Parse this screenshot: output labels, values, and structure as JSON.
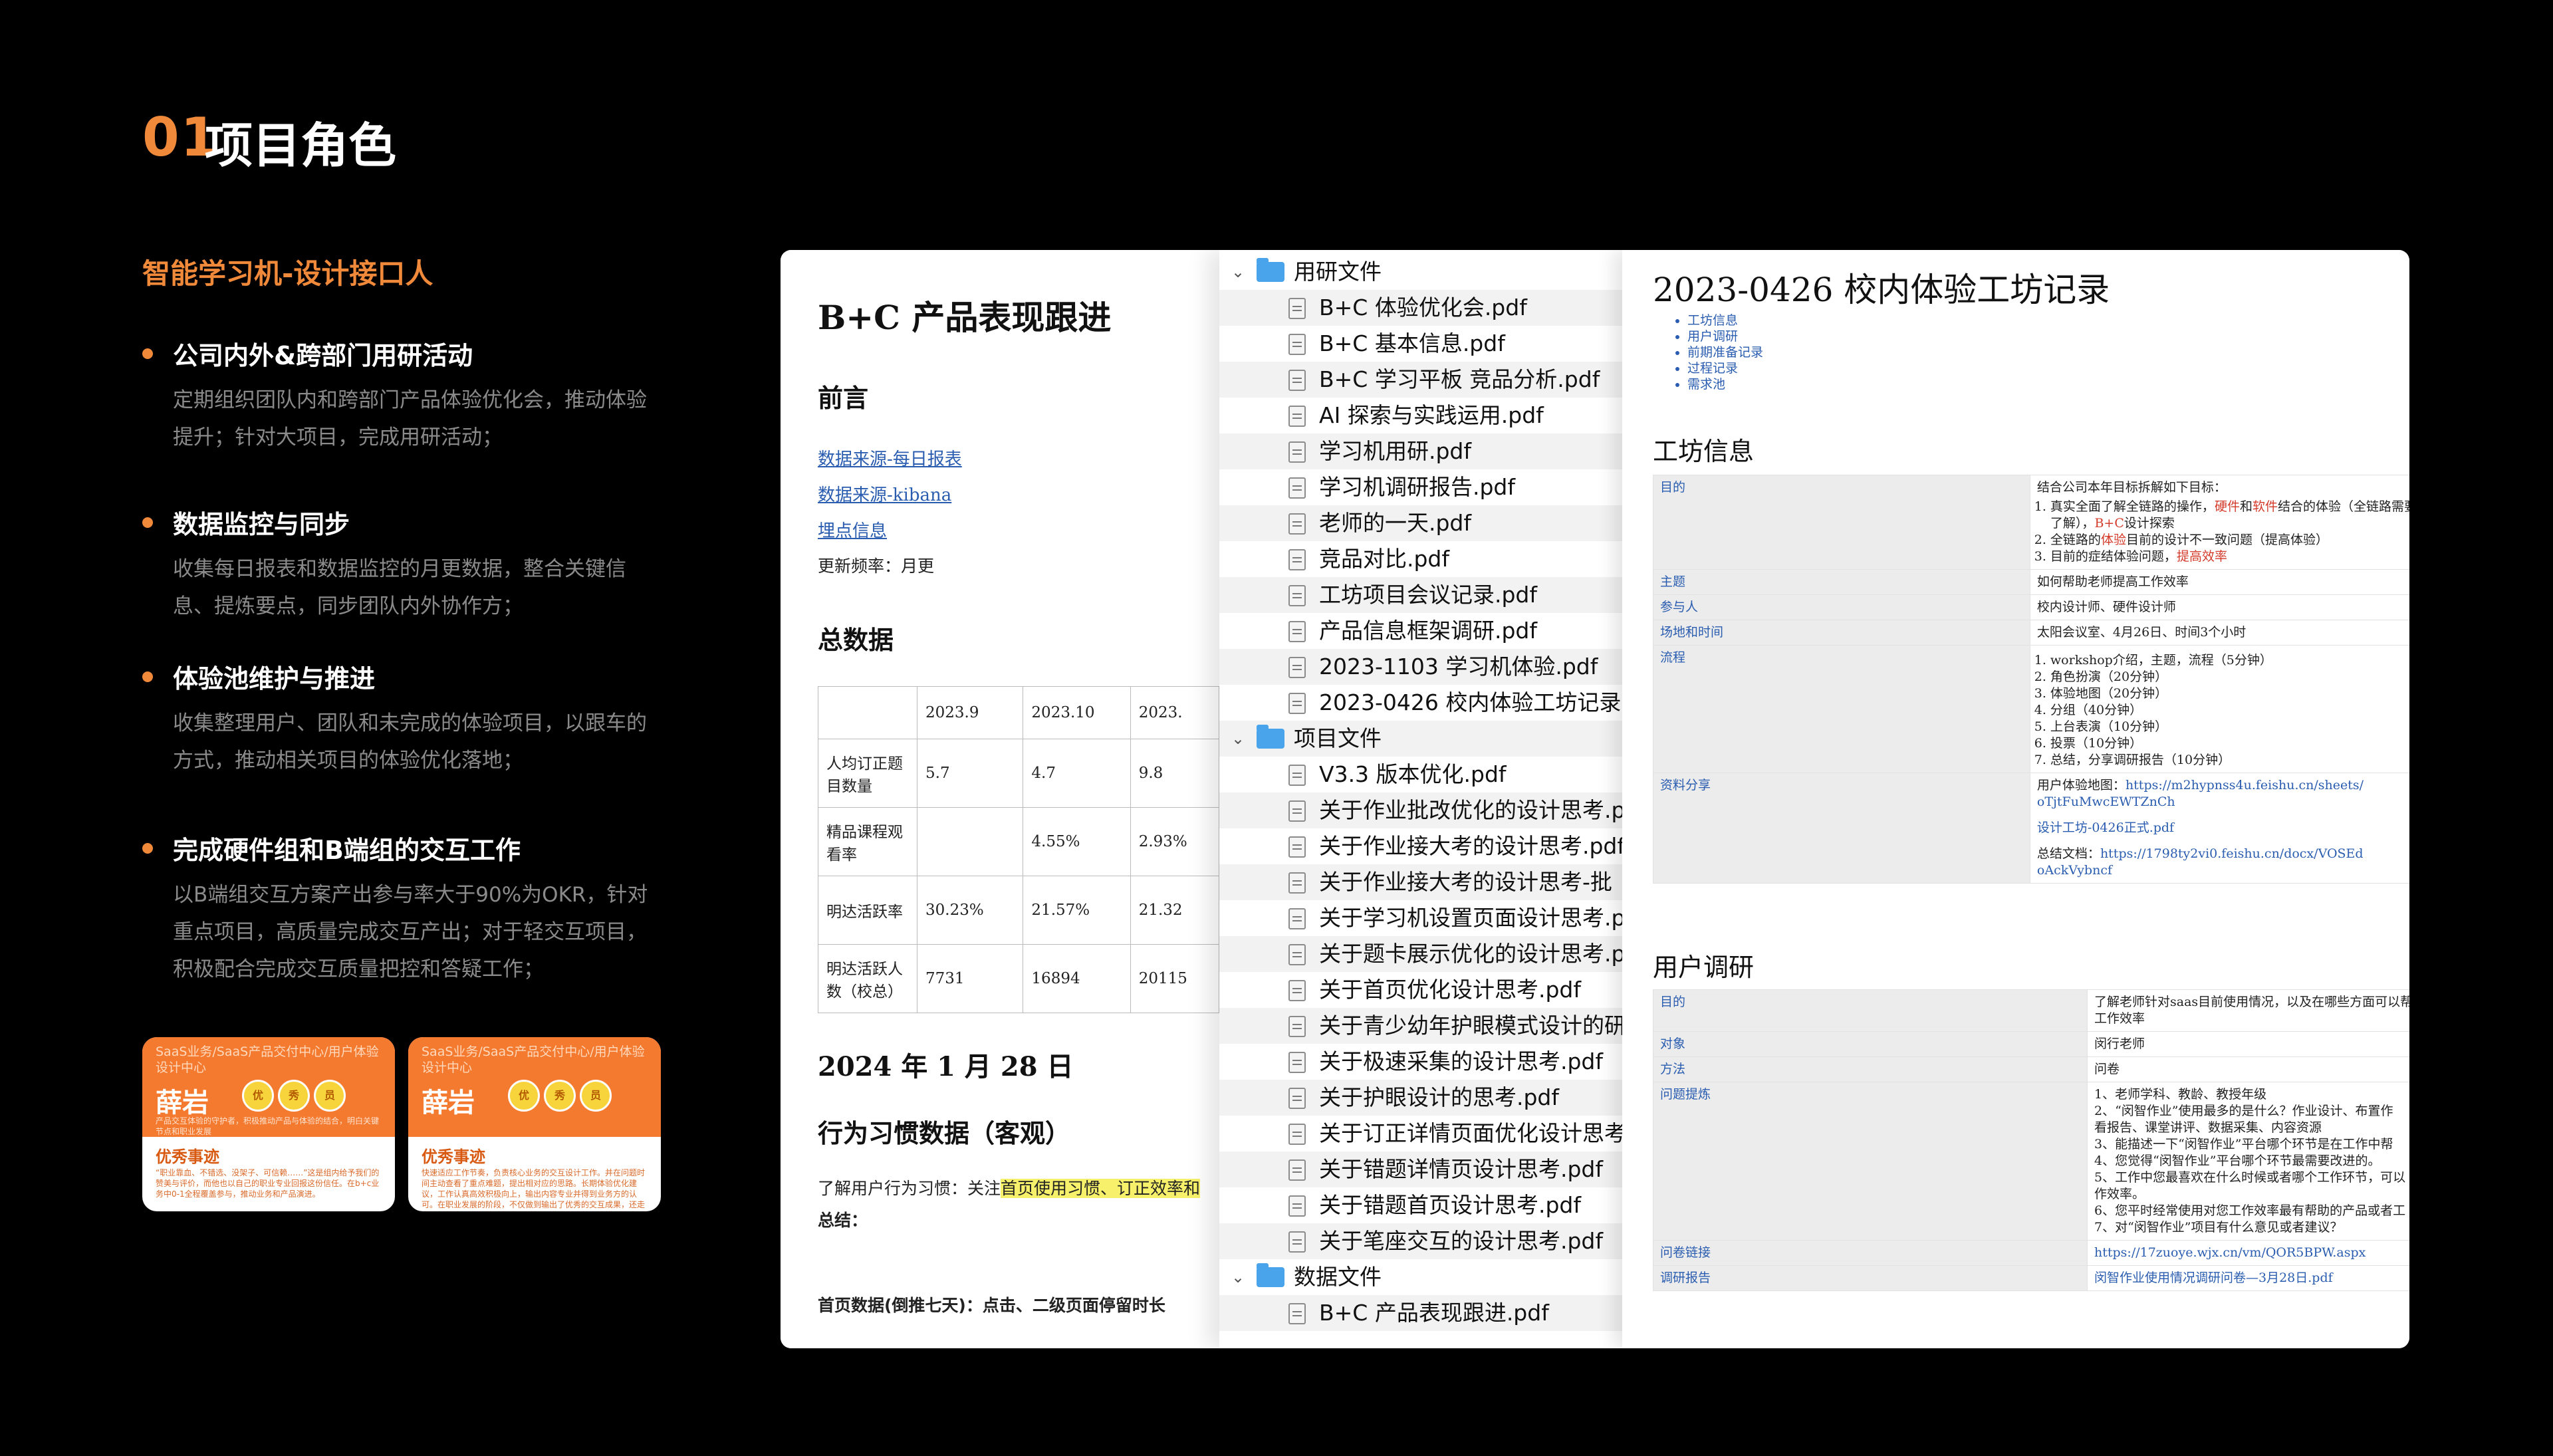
{
  "header": {
    "num": "01",
    "title": "项目角色"
  },
  "subtitle": "智能学习机-设计接口人",
  "points": [
    {
      "title": "公司内外&跨部门用研活动",
      "desc": "定期组织团队内和跨部门产品体验优化会，推动体验提升；针对大项目，完成用研活动；"
    },
    {
      "title": "数据监控与同步",
      "desc": "收集每日报表和数据监控的月更数据，整合关键信息、提炼要点，同步团队内外协作方；"
    },
    {
      "title": "体验池维护与推进",
      "desc": "收集整理用户、团队和未完成的体验项目，以跟车的方式，推动相关项目的体验优化落地；"
    },
    {
      "title": "完成硬件组和B端组的交互工作",
      "desc": "以B端组交互方案产出参与率大于90%为OKR，针对重点项目，高质量完成交互产出；对于轻交互项目，积极配合完成交互质量把控和答疑工作；"
    }
  ],
  "cards": [
    {
      "org": "SaaS业务/SaaS产品交付中心/用户体验设计中心",
      "name": "薛岩",
      "tags": [
        "优",
        "秀",
        "员"
      ],
      "desc": "产品交互体验的守护者，积极推动产品与体验的结合，明白关键节点和职业发展",
      "award": "优秀事迹",
      "award_desc": "“职业靠血、不错选、没架子、可信赖……”这是组内给予我们的赞美与评价，而他也以自己的职业专业回报这份信任。在b+c业务中0-1全程覆盖参与，推动业务和产品演进。"
    },
    {
      "org": "SaaS业务/SaaS产品交付中心/用户体验设计中心",
      "name": "薛岩",
      "tags": [
        "优",
        "秀",
        "员"
      ],
      "desc": "",
      "award": "优秀事迹",
      "award_desc": "快速适应工作节奏，负责核心业务的交互设计工作。并在问题时间主动查看了重点难题，提出相对应的思路。长期体验优化建议，工作认真高效积极向上，输出内容专业并得到业务方的认可。在职业发展的阶段，不仅做到输出了优秀的交互成果，还走查分析输出了多份体验报告，对框架搭建和我的产品模型提高了充分的扫描工作，超预期完成结果。"
    }
  ],
  "doc_a": {
    "title": "B+C 产品表现跟进",
    "preface": "前言",
    "links": [
      "数据来源-每日报表",
      "数据来源-kibana",
      "埋点信息"
    ],
    "freq": "更新频率：月更",
    "total": "总数据",
    "table": {
      "headers": [
        "",
        "2023.9",
        "2023.10",
        "2023."
      ],
      "rows": [
        [
          "人均订正题目数量",
          "5.7",
          "4.7",
          "9.8"
        ],
        [
          "精品课程观看率",
          "",
          "4.55%",
          "2.93%"
        ],
        [
          "明达活跃率",
          "30.23%",
          "21.57%",
          "21.32"
        ],
        [
          "明达活跃人数（校总）",
          "7731",
          "16894",
          "20115"
        ]
      ]
    },
    "date": "2024 年 1 月 28 日",
    "behavior": "行为习惯数据（客观）",
    "understand_prefix": "了解用户行为习惯：关注",
    "understand_hl": "首页使用习惯、订正效率和",
    "summary": "总结：",
    "homepage": "首页数据(倒推七天)：点击、二级页面停留时长"
  },
  "tree": {
    "folders": [
      {
        "name": "用研文件",
        "files": [
          "B+C 体验优化会.pdf",
          "B+C 基本信息.pdf",
          "B+C 学习平板 竞品分析.pdf",
          "AI 探索与实践运用.pdf",
          "学习机用研.pdf",
          "学习机调研报告.pdf",
          "老师的一天.pdf",
          "竞品对比.pdf",
          "工坊项目会议记录.pdf",
          "产品信息框架调研.pdf",
          "2023-1103 学习机体验.pdf",
          "2023-0426 校内体验工坊记录"
        ]
      },
      {
        "name": "项目文件",
        "files": [
          "V3.3 版本优化.pdf",
          "关于作业批改优化的设计思考.p",
          "关于作业接大考的设计思考.pdf",
          "关于作业接大考的设计思考-批",
          "关于学习机设置页面设计思考.p",
          "关于题卡展示优化的设计思考.p",
          "关于首页优化设计思考.pdf",
          "关于青少幼年护眼模式设计的研",
          "关于极速采集的设计思考.pdf",
          "关于护眼设计的思考.pdf",
          "关于订正详情页面优化设计思考",
          "关于错题详情页设计思考.pdf",
          "关于错题首页设计思考.pdf",
          "关于笔座交互的设计思考.pdf"
        ]
      },
      {
        "name": "数据文件",
        "files": [
          "B+C 产品表现跟进.pdf"
        ]
      }
    ]
  },
  "doc_b": {
    "title": "2023-0426 校内体验工坊记录",
    "toc": [
      "工坊信息",
      "用户调研",
      "前期准备记录",
      "过程记录",
      "需求池"
    ],
    "sec1": "工坊信息",
    "goal_key": "目的",
    "goal_intro": "结合公司本年目标拆解如下目标：",
    "goal_items": [
      {
        "pre": "真实全面了解全链路的操作，",
        "r1": "硬件",
        "mid": "和",
        "r2": "软件",
        "post": "结合的体验（全链路需要"
      },
      {
        "pre": "了解），",
        "r1": "B+C",
        "mid": "设计探索",
        "r2": "",
        "post": ""
      },
      {
        "pre": "全链路的",
        "r1": "体验",
        "mid": "目前的设计不一致问题（提高体验）",
        "r2": "",
        "post": ""
      },
      {
        "pre": "目前的症结体验问题，",
        "r1": "提高效率",
        "mid": "",
        "r2": "",
        "post": ""
      }
    ],
    "rows1": [
      {
        "k": "主题",
        "v": "如何帮助老师提高工作效率"
      },
      {
        "k": "参与人",
        "v": "校内设计师、硬件设计师"
      },
      {
        "k": "场地和时间",
        "v": "太阳会议室、4月26日、时间3个小时"
      }
    ],
    "flow_key": "流程",
    "flow": [
      "workshop介绍，主题，流程（5分钟）",
      "角色扮演（20分钟）",
      "体验地图（20分钟）",
      "分组（40分钟）",
      "上台表演（10分钟）",
      "投票（10分钟）",
      "总结，分享调研报告（10分钟）"
    ],
    "share_key": "资料分享",
    "share": {
      "map_label": "用户体验地图：",
      "map_url": "https://m2hypnss4u.feishu.cn/sheets/",
      "map_url2": "oTjtFuMwcEWTZnCh",
      "pdf": "设计工坊-0426正式.pdf",
      "sum_label": "总结文档：",
      "sum_url": "https://1798ty2vi0.feishu.cn/docx/VOSEd",
      "sum_url2": "oAckVybncf"
    },
    "sec2": "用户调研",
    "rows2": [
      {
        "k": "目的",
        "v": "了解老师针对saas目前使用情况，以及在哪些方面可以帮",
        "v2": "工作效率"
      },
      {
        "k": "对象",
        "v": "闵行老师"
      },
      {
        "k": "方法",
        "v": "问卷"
      }
    ],
    "q_key": "问题提炼",
    "questions": [
      "1、老师学科、教龄、教授年级",
      "2、“闵智作业”使用最多的是什么？作业设计、布置作",
      "看报告、课堂讲评、数据采集、内容资源",
      "3、能描述一下“闵智作业”平台哪个环节是在工作中帮",
      "4、您觉得“闵智作业”平台哪个环节最需要改进的。",
      "5、工作中您最喜欢在什么时候或者哪个工作环节，可以",
      "作效率。",
      "6、您平时经常使用对您工作效率最有帮助的产品或者工",
      "7、对“闵智作业”项目有什么意见或者建议？"
    ],
    "q_link_key": "问卷链接",
    "q_link": "https://17zuoye.wjx.cn/vm/QOR5BPW.aspx",
    "report_key": "调研报告",
    "report": "闵智作业使用情况调研问卷—3月28日.pdf"
  }
}
